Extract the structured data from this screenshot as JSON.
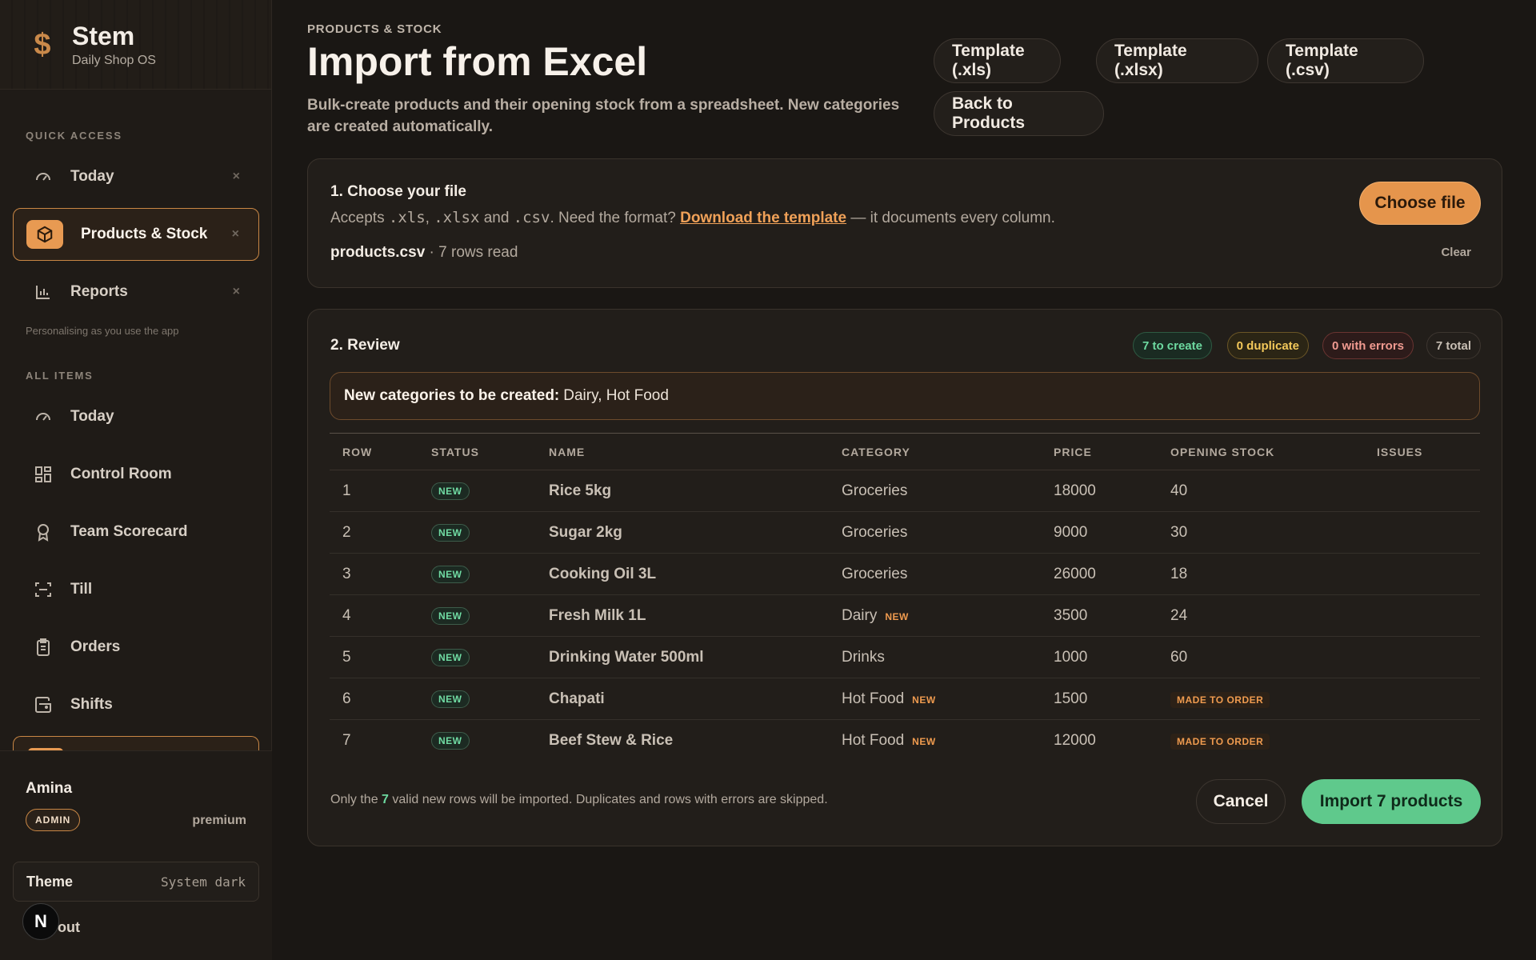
{
  "brand": {
    "logo_glyph": "$",
    "name": "Stem",
    "tagline": "Daily Shop OS"
  },
  "sidebar": {
    "quick_access_label": "QUICK ACCESS",
    "quick_items": [
      {
        "label": "Today",
        "icon": "gauge-icon"
      },
      {
        "label": "Products & Stock",
        "icon": "box-icon",
        "active": true
      },
      {
        "label": "Reports",
        "icon": "bar-chart-icon"
      }
    ],
    "personalising_hint": "Personalising as you use the app",
    "all_items_label": "ALL ITEMS",
    "all_items": [
      {
        "label": "Today",
        "icon": "gauge-icon"
      },
      {
        "label": "Control Room",
        "icon": "grid-icon"
      },
      {
        "label": "Team Scorecard",
        "icon": "award-icon"
      },
      {
        "label": "Till",
        "icon": "scan-icon"
      },
      {
        "label": "Orders",
        "icon": "clipboard-icon"
      },
      {
        "label": "Shifts",
        "icon": "wallet-icon"
      }
    ],
    "close_glyph": "×"
  },
  "user": {
    "name": "Amina",
    "role": "ADMIN",
    "plan": "premium"
  },
  "theme": {
    "label": "Theme",
    "value": "System dark"
  },
  "logout_label": "out",
  "floating_badge": "N",
  "page": {
    "eyebrow": "PRODUCTS & STOCK",
    "title": "Import from Excel",
    "description": "Bulk-create products and their opening stock from a spreadsheet. New categories are created automatically."
  },
  "header_buttons": {
    "template_xls": "Template (.xls)",
    "template_xlsx": "Template (.xlsx)",
    "template_csv": "Template (.csv)",
    "back": "Back to Products"
  },
  "step1": {
    "title": "1. Choose your file",
    "accepts_prefix": "Accepts",
    "ext_xls": ".xls",
    "ext_xlsx": ".xlsx",
    "and": "and",
    "ext_csv": ".csv",
    "need_format": ". Need the format?",
    "template_link": "Download the template",
    "suffix": "— it documents every column.",
    "file_name": "products.csv",
    "rows_read": "· 7 rows read",
    "choose_button": "Choose file",
    "clear_button": "Clear"
  },
  "step2": {
    "title": "2. Review",
    "chips": {
      "create": "7 to create",
      "duplicate": "0 duplicate",
      "errors": "0 with errors",
      "total": "7 total"
    },
    "new_categories_label": "New categories to be created:",
    "new_categories_value": "Dairy, Hot Food",
    "columns": [
      "ROW",
      "STATUS",
      "NAME",
      "CATEGORY",
      "PRICE",
      "OPENING STOCK",
      "ISSUES"
    ],
    "status_new": "NEW",
    "category_new_tag": "NEW",
    "made_to_order": "MADE TO ORDER",
    "rows": [
      {
        "row": "1",
        "name": "Rice 5kg",
        "category": "Groceries",
        "price": "18000",
        "stock": "40"
      },
      {
        "row": "2",
        "name": "Sugar 2kg",
        "category": "Groceries",
        "price": "9000",
        "stock": "30"
      },
      {
        "row": "3",
        "name": "Cooking Oil 3L",
        "category": "Groceries",
        "price": "26000",
        "stock": "18"
      },
      {
        "row": "4",
        "name": "Fresh Milk 1L",
        "category": "Dairy",
        "price": "3500",
        "stock": "24"
      },
      {
        "row": "5",
        "name": "Drinking Water 500ml",
        "category": "Drinks",
        "price": "1000",
        "stock": "60"
      },
      {
        "row": "6",
        "name": "Chapati",
        "category": "Hot Food",
        "price": "1500",
        "stock": ""
      },
      {
        "row": "7",
        "name": "Beef Stew & Rice",
        "category": "Hot Food",
        "price": "12000",
        "stock": ""
      }
    ],
    "footnote_prefix": "Only the",
    "footnote_count": "7",
    "footnote_suffix": "valid new rows will be imported. Duplicates and rows with errors are skipped.",
    "cancel_button": "Cancel",
    "import_button": "Import 7 products"
  }
}
